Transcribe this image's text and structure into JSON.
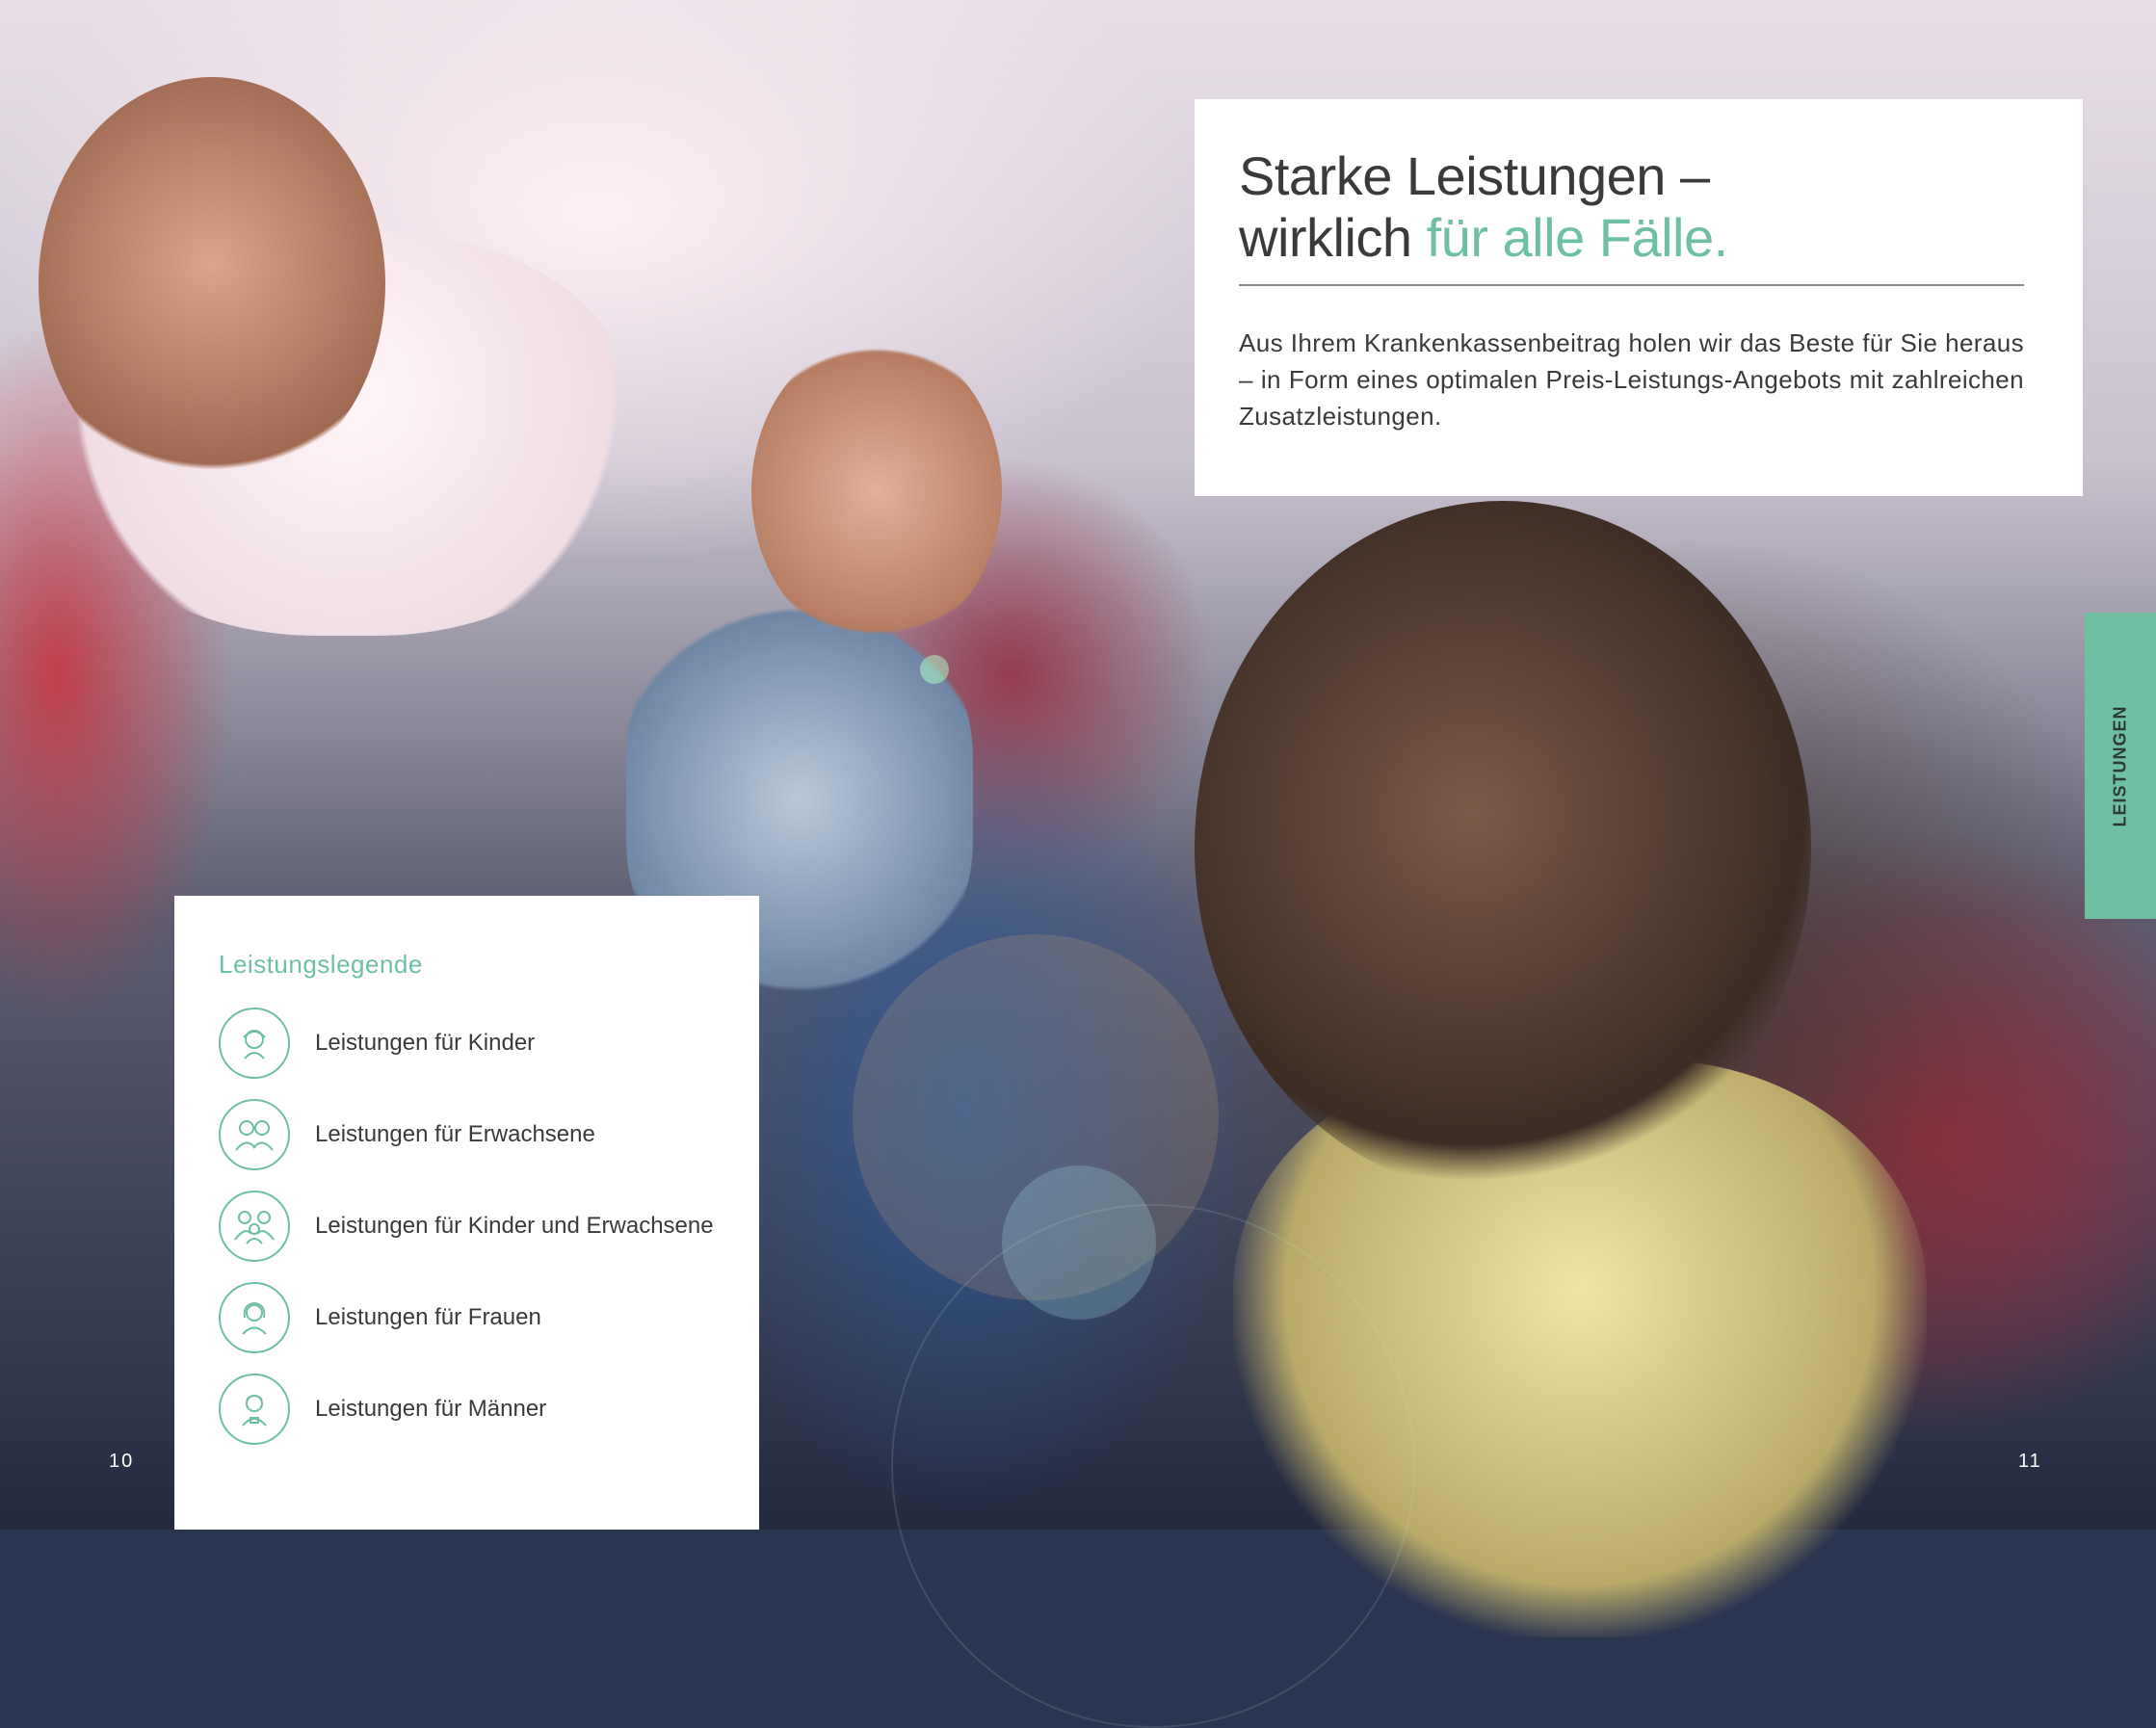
{
  "headline": {
    "line1": "Starke Leistungen –",
    "line2_plain": "wirklich ",
    "line2_accent": "für alle Fälle."
  },
  "intro_text": "Aus Ihrem Krankenkassenbeitrag holen wir das Beste für Sie heraus – in Form eines optimalen Preis-Leistungs-Angebots mit zahlreichen Zusatzleistungen.",
  "legend": {
    "title": "Leistungslegende",
    "items": [
      {
        "label": "Leistungen für Kinder",
        "icon": "child-icon"
      },
      {
        "label": "Leistungen für Erwachsene",
        "icon": "adults-icon"
      },
      {
        "label": "Leistungen für Kinder und Erwachsene",
        "icon": "family-icon"
      },
      {
        "label": "Leistungen für Frauen",
        "icon": "woman-icon"
      },
      {
        "label": "Leistungen für Männer",
        "icon": "man-icon"
      }
    ]
  },
  "side_tab": "LEISTUNGEN",
  "page_numbers": {
    "left": "10",
    "right": "11"
  },
  "colors": {
    "accent": "#6fbfa3",
    "text": "#3a3a3a",
    "card": "#ffffff"
  }
}
